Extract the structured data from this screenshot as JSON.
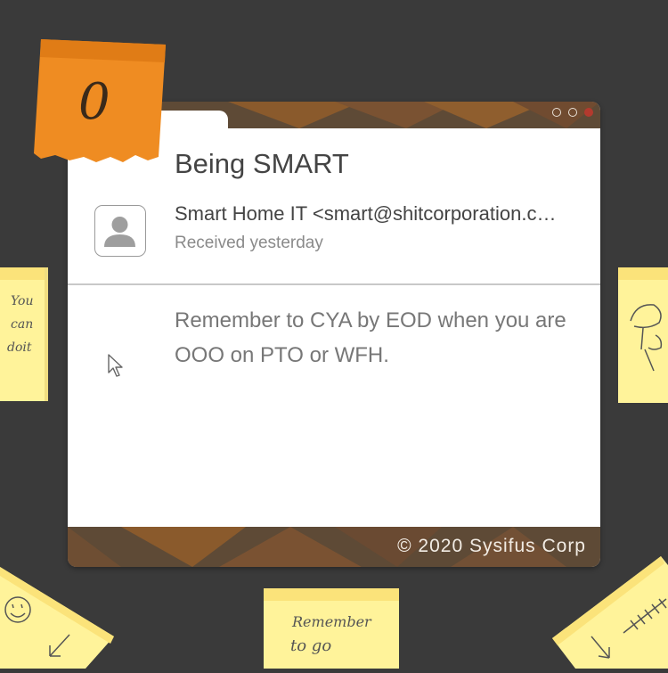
{
  "window": {
    "title": "Being SMART",
    "sender": "Smart Home IT <smart@shitcorporation.com>",
    "received": "Received yesterday",
    "body": "Remember to CYA by EOD when you are OOO on PTO or WFH.",
    "footer": "© 2020 Sysifus Corp"
  },
  "notes": {
    "orange": "0",
    "left": [
      "You",
      "can",
      "doit"
    ],
    "bottom": [
      "Remember",
      "to go"
    ]
  },
  "icons": {
    "avatar": "person-icon",
    "cursor": "mouse-pointer-icon",
    "window_controls": [
      "minimize-icon",
      "maximize-icon",
      "close-icon"
    ]
  },
  "colors": {
    "background": "#3a3a3a",
    "window_bar": "#5e4a36",
    "sticky_orange": "#ef8c22",
    "sticky_yellow": "#fff39a",
    "close": "#b33a2e"
  }
}
